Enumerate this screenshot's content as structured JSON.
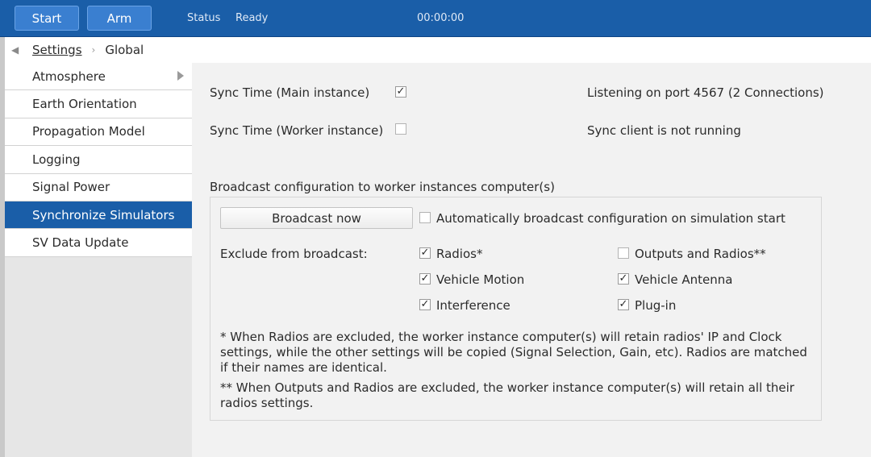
{
  "toolbar": {
    "start_label": "Start",
    "arm_label": "Arm",
    "status_label": "Status",
    "status_value": "Ready",
    "timer": "00:00:00"
  },
  "breadcrumb": {
    "root": "Settings",
    "current": "Global"
  },
  "sidebar": {
    "items": [
      {
        "label": "Atmosphere",
        "has_submenu": true
      },
      {
        "label": "Earth Orientation"
      },
      {
        "label": "Propagation Model"
      },
      {
        "label": "Logging"
      },
      {
        "label": "Signal Power"
      },
      {
        "label": "Synchronize Simulators",
        "active": true
      },
      {
        "label": "SV Data Update"
      }
    ]
  },
  "sync": {
    "main_label": "Sync Time (Main instance)",
    "main_checked": true,
    "worker_label": "Sync Time (Worker instance)",
    "worker_checked": false,
    "listening_status": "Listening on port 4567 (2 Connections)",
    "client_status": "Sync client is not running"
  },
  "broadcast": {
    "section_title": "Broadcast configuration to worker instances computer(s)",
    "button_label": "Broadcast now",
    "auto_label": "Automatically broadcast configuration on simulation start",
    "auto_checked": false,
    "exclude_label": "Exclude from broadcast:",
    "options": [
      {
        "label": "Radios*",
        "checked": true
      },
      {
        "label": "Vehicle Motion",
        "checked": true
      },
      {
        "label": "Interference",
        "checked": true
      },
      {
        "label": "Outputs and Radios**",
        "checked": false
      },
      {
        "label": "Vehicle Antenna",
        "checked": true
      },
      {
        "label": "Plug-in",
        "checked": true
      }
    ],
    "note1": "* When Radios are excluded, the worker instance computer(s) will retain radios' IP and Clock settings, while the other settings will be copied (Signal Selection, Gain, etc). Radios are matched if their names are identical.",
    "note2": "** When Outputs and Radios are excluded, the worker instance computer(s) will retain all their radios settings."
  },
  "colors": {
    "header_blue": "#1a5ea8",
    "active_item": "#1a5ea8"
  },
  "icons": {
    "back": "chevron-left-icon",
    "separator": "chevron-right-icon",
    "submenu": "triangle-right-icon",
    "check": "checkmark-icon"
  }
}
